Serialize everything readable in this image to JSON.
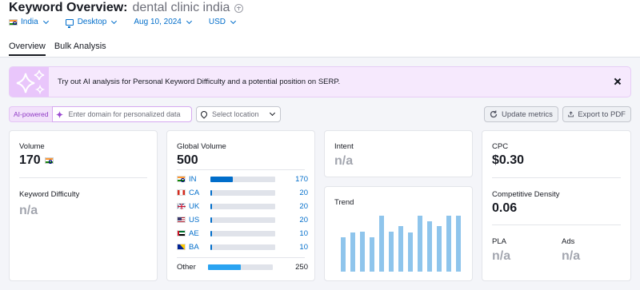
{
  "header": {
    "title": "Keyword Overview:",
    "keyword": "dental clinic india",
    "filters": {
      "country": "India",
      "device": "Desktop",
      "date": "Aug 10, 2024",
      "currency": "USD"
    }
  },
  "tabs": [
    {
      "label": "Overview",
      "active": true
    },
    {
      "label": "Bulk Analysis",
      "active": false
    }
  ],
  "banner": {
    "text_before": "Try out ",
    "link": "AI analysis",
    "text_after": " for Personal Keyword Difficulty and a potential position on SERP."
  },
  "toolbar": {
    "ai_badge": "AI-powered",
    "domain_placeholder": "Enter domain for personalized data",
    "location_placeholder": "Select location",
    "update_label": "Update metrics",
    "export_label": "Export to PDF"
  },
  "cards": {
    "volume": {
      "label": "Volume",
      "value": "170"
    },
    "kd": {
      "label": "Keyword Difficulty",
      "value": "n/a"
    },
    "global_volume": {
      "label": "Global Volume",
      "value": "500",
      "rows": [
        {
          "code": "IN",
          "value": "170",
          "share": 0.34
        },
        {
          "code": "CA",
          "value": "20",
          "share": 0.03
        },
        {
          "code": "UK",
          "value": "20",
          "share": 0.03
        },
        {
          "code": "US",
          "value": "20",
          "share": 0.03
        },
        {
          "code": "AE",
          "value": "10",
          "share": 0.02
        },
        {
          "code": "BA",
          "value": "10",
          "share": 0.02
        }
      ],
      "other": {
        "label": "Other",
        "value": "250",
        "share": 0.5
      }
    },
    "intent": {
      "label": "Intent",
      "value": "n/a"
    },
    "trend": {
      "label": "Trend",
      "values": [
        0.61,
        0.69,
        0.71,
        0.61,
        0.98,
        0.71,
        0.8,
        0.69,
        0.98,
        0.89,
        0.8,
        0.98,
        0.98
      ]
    },
    "cpc": {
      "label": "CPC",
      "value": "$0.30"
    },
    "competitive_density": {
      "label": "Competitive Density",
      "value": "0.06"
    },
    "pla": {
      "label": "PLA",
      "value": "n/a"
    },
    "ads": {
      "label": "Ads",
      "value": "n/a"
    }
  },
  "colors": {
    "accent": "#006dca",
    "trend_bar": "#8fc5ec",
    "other_bar": "#2aa3f1",
    "banner_bg": "#f6e9fd"
  }
}
